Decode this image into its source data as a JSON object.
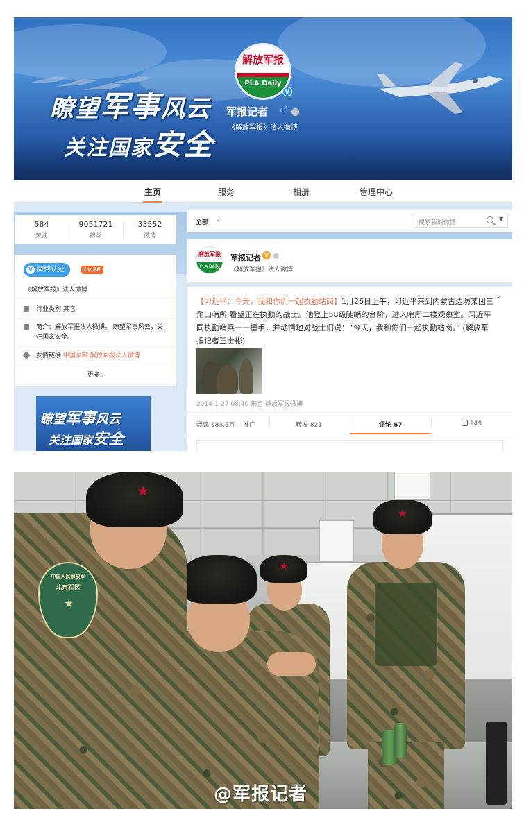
{
  "cover": {
    "slogan_line1_a": "瞭望",
    "slogan_line1_b": "军事",
    "slogan_line1_c": "风云",
    "slogan_line2_a": "关注国家",
    "slogan_line2_b": "安全",
    "avatar_logo_cn": "解放军报",
    "avatar_logo_en": "PLA Daily",
    "account_name": "军报记者",
    "gender_icon": "♂",
    "description": "《解放军报》法人微博"
  },
  "tabs": [
    {
      "label": "主页",
      "active": true
    },
    {
      "label": "服务",
      "active": false
    },
    {
      "label": "相册",
      "active": false
    },
    {
      "label": "管理中心",
      "active": false
    }
  ],
  "stats": [
    {
      "value": "584",
      "label": "关注"
    },
    {
      "value": "9051721",
      "label": "粉丝"
    },
    {
      "value": "33552",
      "label": "微博"
    }
  ],
  "info": {
    "verified_label": "微博认证",
    "level": "Lv.26",
    "verify_desc": "《解放军报》法人微博",
    "industry_label": "行业类别",
    "industry_value": "其它",
    "intro_label": "简介：",
    "intro_text": "解放军报法人微博。 瞭望军事风云，关注国家安全。",
    "links_label": "友情链接",
    "link1": "中国军网",
    "link2": "解放军报法人微博",
    "more": "更多 ›"
  },
  "promo": {
    "line1_a": "瞭望",
    "line1_b": "军事",
    "line1_c": "风云",
    "line2_a": "关注国家",
    "line2_b": "安全"
  },
  "feed": {
    "filter_all": "全部",
    "search_placeholder": "搜索我的微博",
    "profile_name": "军报记者",
    "profile_desc": "《解放军报》法人微博",
    "post_topic": "【习近平：今天，我和你们一起执勤站岗】",
    "post_body": "1月26日上午，习近平来到内蒙古边防某团三角山哨所,看望正在执勤的战士。他登上58级陡峭的台阶，进入哨所二楼观察室。习近平同执勤哨兵一一握手，并动情地对战士们说：“今天，我和你们一起执勤站岗。” (解放军报记者王士彬)",
    "post_time": "2014-1-27 08:40",
    "post_source_prefix": "来自",
    "post_source": "解放军报微博",
    "reads": "阅读 183.5万",
    "promote": "推广",
    "reposts": "转发 821",
    "comments": "评论 67",
    "likes": "149"
  },
  "photo": {
    "patch_line1": "中国人民解放军",
    "patch_line2": "北京军区",
    "watermark": "@军报记者"
  },
  "colors": {
    "accent_orange": "#fa7d3c",
    "link_orange": "#eb7350",
    "verify_blue": "#3ea0e9",
    "level_orange": "#fa6a2c"
  }
}
